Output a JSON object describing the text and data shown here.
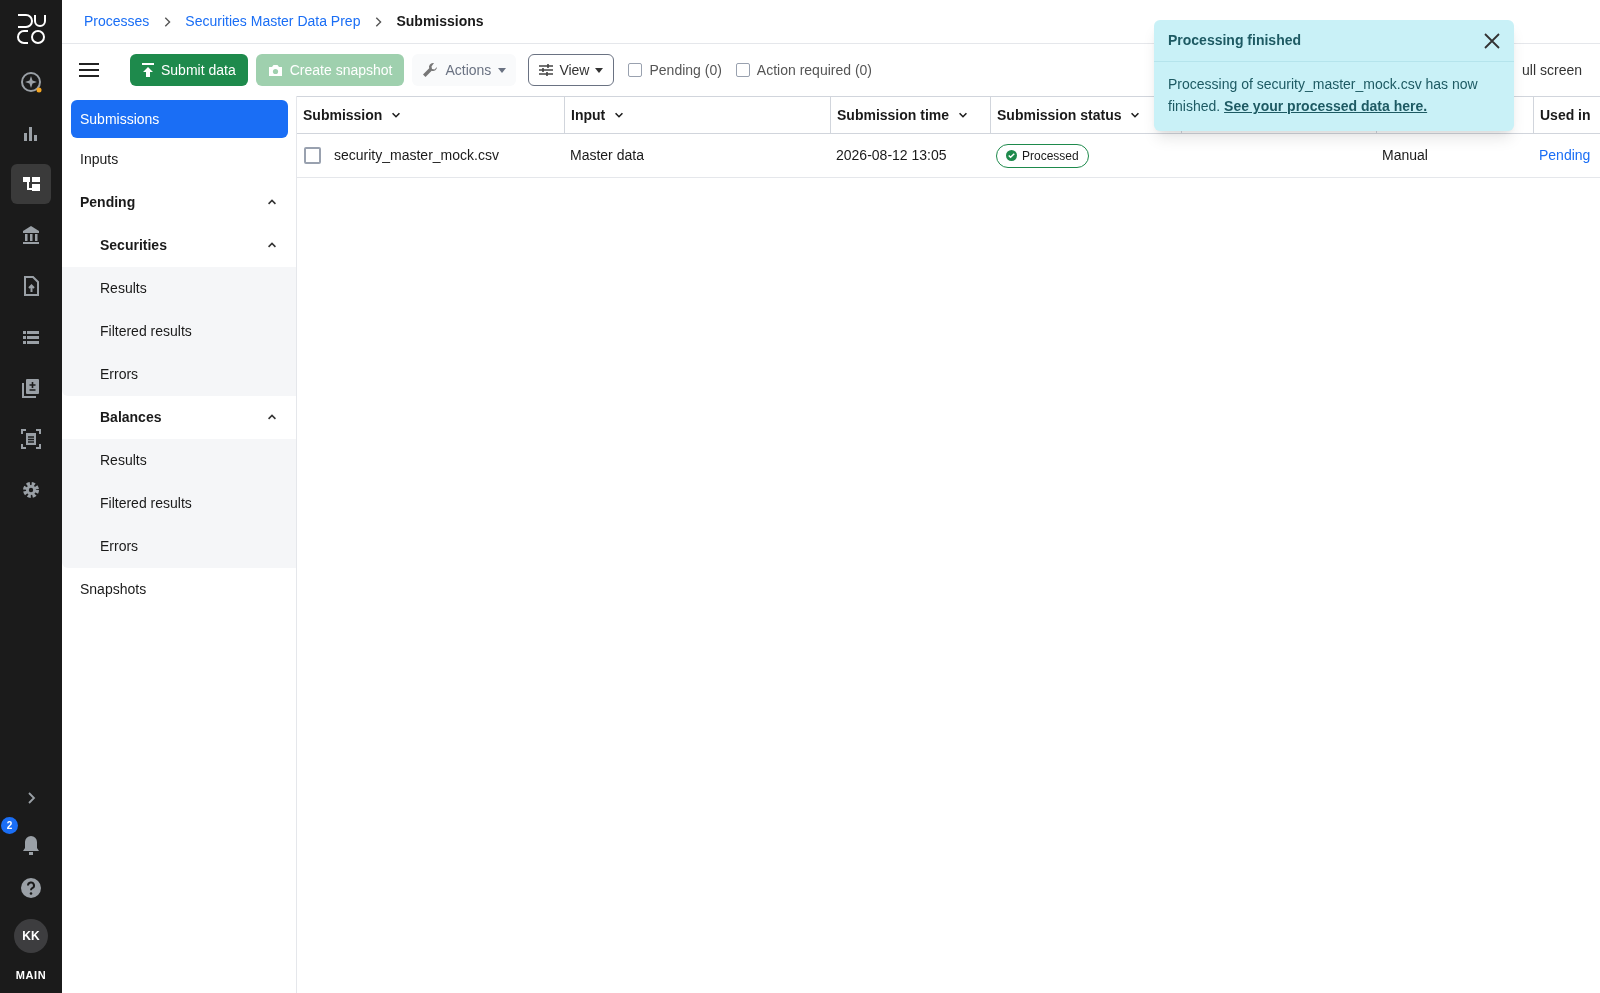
{
  "rail": {
    "items": [
      {
        "selected": false
      },
      {
        "selected": false
      },
      {
        "selected": true
      },
      {
        "selected": false
      },
      {
        "selected": false
      },
      {
        "selected": false
      },
      {
        "selected": false
      },
      {
        "selected": false
      },
      {
        "selected": false
      }
    ],
    "notifications": {
      "count": "2"
    },
    "avatar": {
      "initials": "KK"
    },
    "environment": "MAIN"
  },
  "breadcrumbs": [
    {
      "label": "Processes",
      "current": false
    },
    {
      "label": "Securities Master Data Prep",
      "current": false
    },
    {
      "label": "Submissions",
      "current": true
    }
  ],
  "toolbar": {
    "buttons": [
      {
        "kind": "primary",
        "label": "Submit data",
        "disabled": false
      },
      {
        "kind": "primary",
        "label": "Create snapshot",
        "disabled": true
      },
      {
        "kind": "menu",
        "label": "Actions",
        "disabled": false
      },
      {
        "kind": "outline",
        "label": "View",
        "disabled": false
      }
    ],
    "filters": [
      {
        "label": "Pending (0)",
        "checked": false
      },
      {
        "label": "Action required (0)",
        "checked": false
      }
    ],
    "right": [
      {
        "kind": "fullscreen",
        "label": "ull screen"
      }
    ]
  },
  "nav": [
    {
      "label": "Submissions",
      "selected": true
    },
    {
      "label": "Inputs",
      "selected": false
    },
    {
      "label": "Pending",
      "selected": false,
      "expanded": true,
      "children": [
        {
          "label": "Securities",
          "selected": false,
          "expanded": true,
          "children": [
            {
              "label": "Results",
              "selected": false
            },
            {
              "label": "Filtered results",
              "selected": false
            },
            {
              "label": "Errors",
              "selected": false
            }
          ]
        },
        {
          "label": "Balances",
          "selected": false,
          "expanded": true,
          "children": [
            {
              "label": "Results",
              "selected": false
            },
            {
              "label": "Filtered results",
              "selected": false
            },
            {
              "label": "Errors",
              "selected": false
            }
          ]
        }
      ]
    },
    {
      "label": "Snapshots",
      "selected": false
    }
  ],
  "table": {
    "columns": [
      "Submission",
      "Input",
      "Submission time",
      "Submission status",
      "Used in"
    ],
    "rows": [
      {
        "checked": false,
        "submission": "security_master_mock.csv",
        "input": "Master data",
        "time": "2026-08-12 13:05",
        "status": "Processed",
        "submitted_by": "Manual",
        "used_in": "Pending"
      }
    ]
  },
  "toast": {
    "title": "Processing finished",
    "message": "Processing of security_master_mock.csv has now finished.",
    "link": "See your processed data here."
  }
}
